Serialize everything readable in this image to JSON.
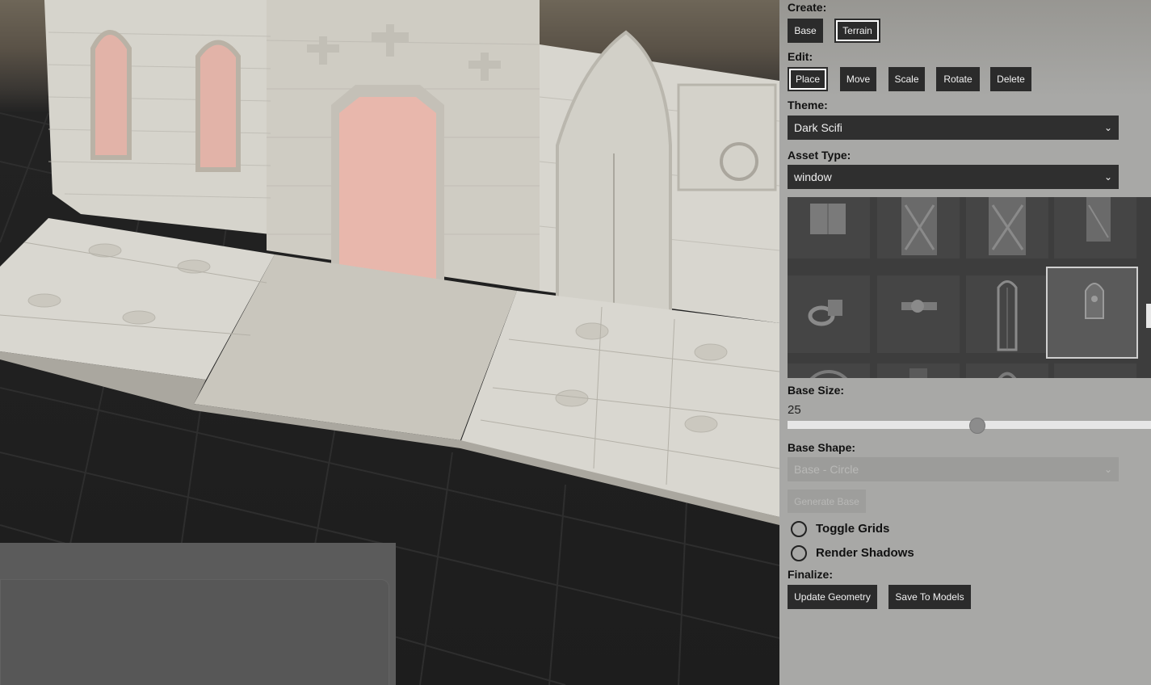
{
  "panel": {
    "create_label": "Create:",
    "create_buttons": [
      "Base",
      "Terrain"
    ],
    "edit_label": "Edit:",
    "edit_buttons": [
      "Place",
      "Move",
      "Scale",
      "Rotate",
      "Delete"
    ],
    "theme_label": "Theme:",
    "theme_value": "Dark Scifi",
    "asset_type_label": "Asset Type:",
    "asset_type_value": "window",
    "base_size_label": "Base Size:",
    "base_size_value": "25",
    "base_size_slider_fraction": 0.52,
    "base_shape_label": "Base Shape:",
    "base_shape_value": "Base - Circle",
    "generate_base": "Generate Base",
    "toggle_grids": "Toggle Grids",
    "render_shadows": "Render Shadows",
    "finalize_label": "Finalize:",
    "finalize_buttons": [
      "Update Geometry",
      "Save To Models"
    ]
  },
  "assets": {
    "thumbnails": [
      "window-shutter",
      "gothic-window-a",
      "gothic-window-b",
      "gothic-window-c",
      "pipe-fitting",
      "wall-light",
      "tall-grate-window",
      "arched-window",
      "round-emblem",
      "small-window",
      "aquila-window",
      "blank"
    ],
    "selected_index": 7
  },
  "colors": {
    "button_bg": "#2b2b2b",
    "panel_bg": "#a8a8a6",
    "highlight_door": "#e8b7ac"
  }
}
